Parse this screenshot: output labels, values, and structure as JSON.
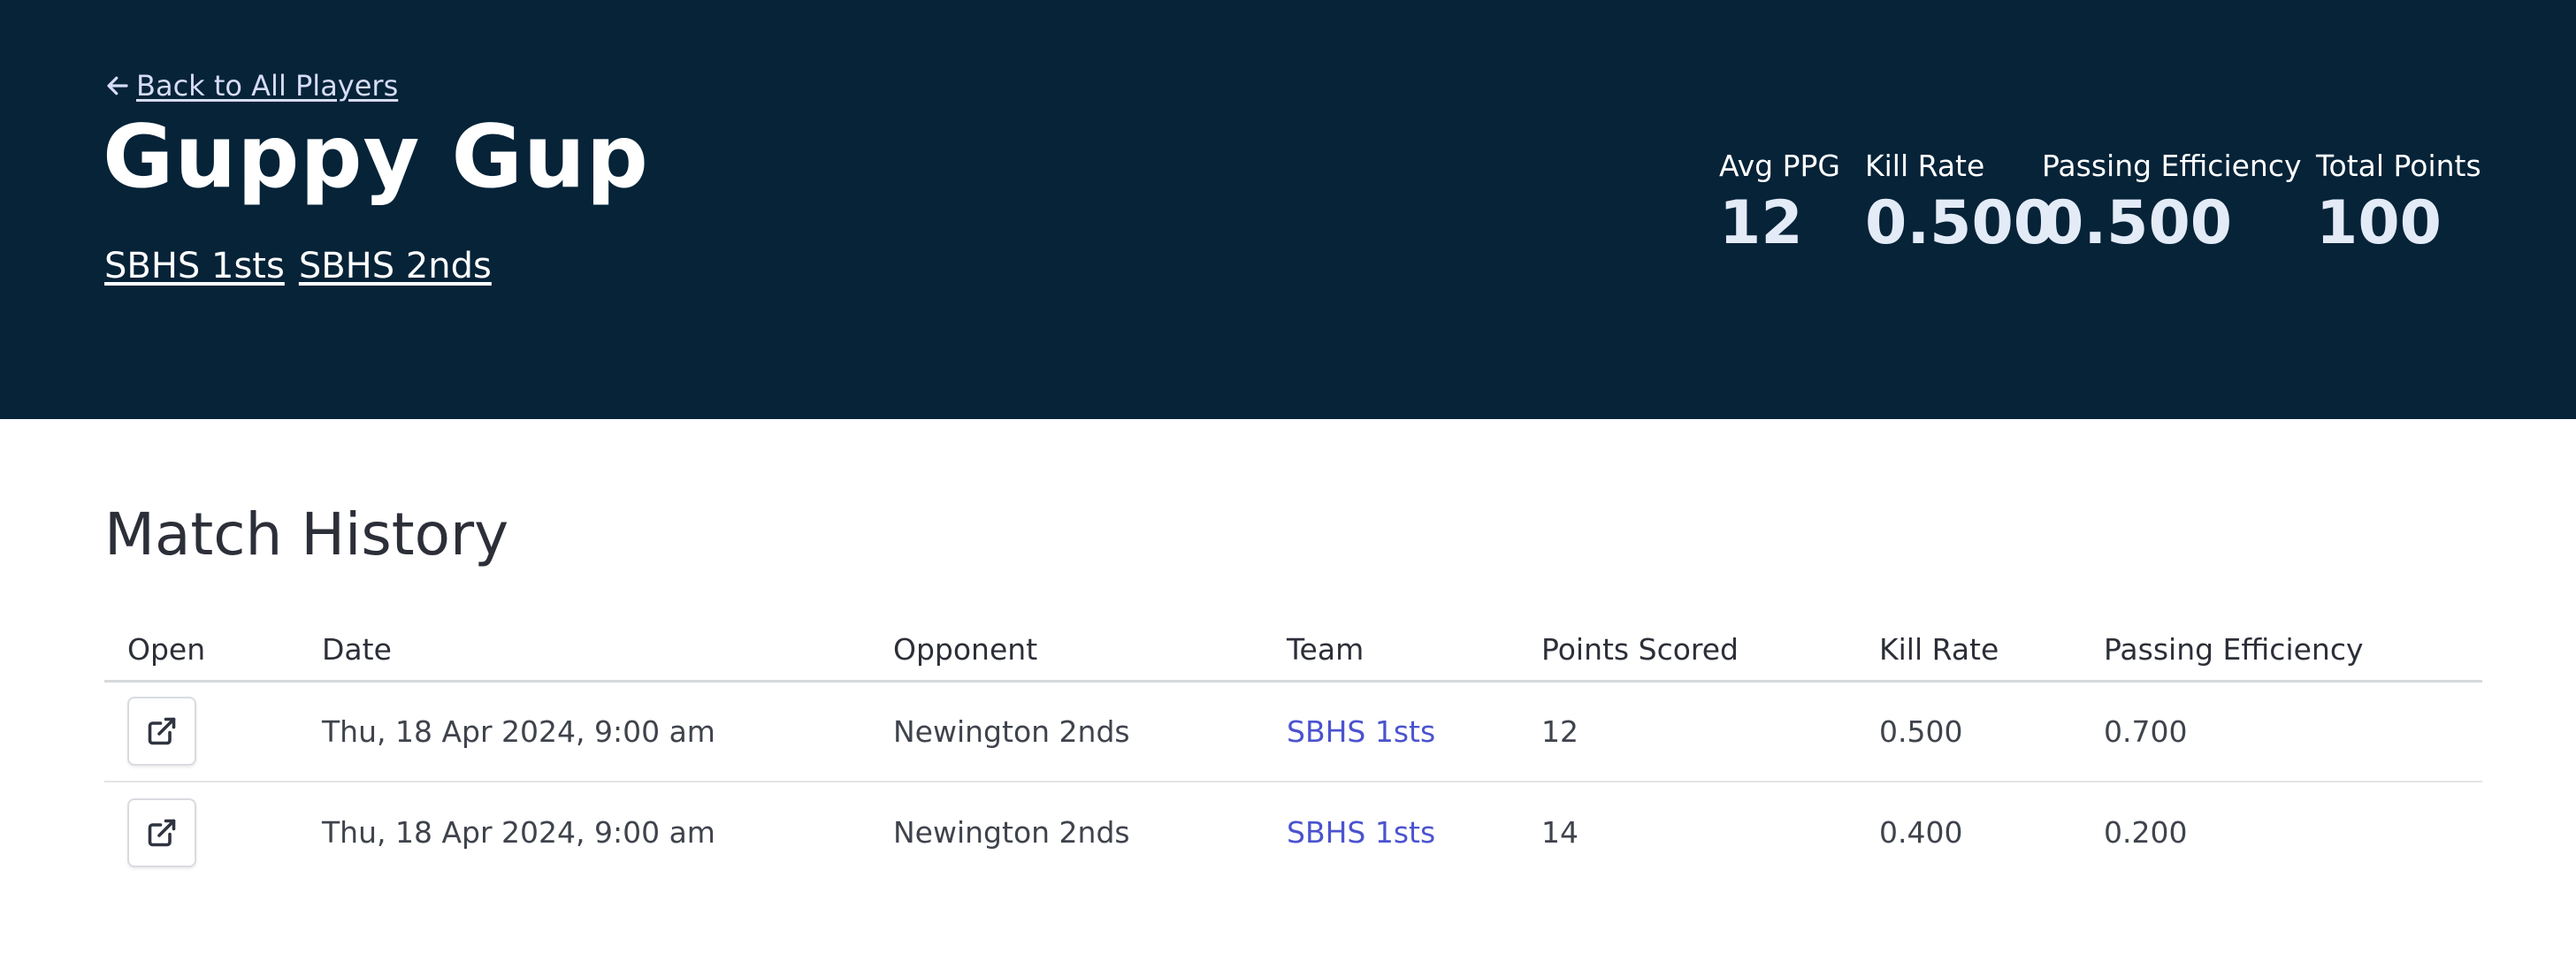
{
  "hero": {
    "back_link_label": "Back to All Players",
    "player_name": "Guppy Gup",
    "teams": [
      "SBHS 1sts",
      "SBHS 2nds"
    ]
  },
  "stats": [
    {
      "label": "Avg PPG",
      "value": "12"
    },
    {
      "label": "Kill Rate",
      "value": "0.500"
    },
    {
      "label": "Passing Efficiency",
      "value": "0.500"
    },
    {
      "label": "Total Points",
      "value": "100"
    }
  ],
  "match_history": {
    "title": "Match History",
    "columns": [
      "Open",
      "Date",
      "Opponent",
      "Team",
      "Points Scored",
      "Kill Rate",
      "Passing Efficiency"
    ],
    "rows": [
      {
        "date": "Thu, 18 Apr 2024, 9:00 am",
        "opponent": "Newington 2nds",
        "team": "SBHS 1sts",
        "points": "12",
        "kill_rate": "0.500",
        "passing": "0.700"
      },
      {
        "date": "Thu, 18 Apr 2024, 9:00 am",
        "opponent": "Newington 2nds",
        "team": "SBHS 1sts",
        "points": "14",
        "kill_rate": "0.400",
        "passing": "0.200"
      }
    ]
  },
  "colors": {
    "hero_bg": "#062338",
    "link_accent": "#4b53cf"
  },
  "icons": {
    "back": "arrow-left-icon",
    "open": "external-link-icon"
  }
}
